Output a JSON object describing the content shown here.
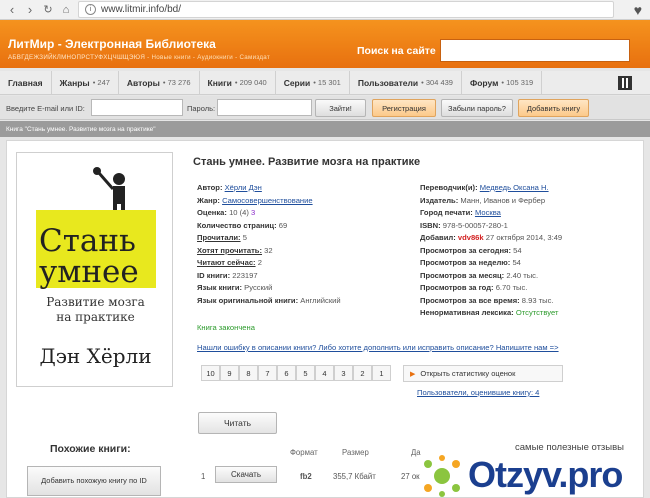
{
  "browser": {
    "url": "www.litmir.info/bd/"
  },
  "header": {
    "title": "ЛитМир - Электронная Библиотека",
    "alphabet": "АБВГДЕЖЗИЙКЛМНОПРСТУФХЦЧШЩЭЮЯ",
    "sublinks": "- Новые книги - Аудиокниги - Самиздат",
    "search_label": "Поиск на сайте"
  },
  "nav": [
    {
      "label": "Главная",
      "count": ""
    },
    {
      "label": "Жанры",
      "count": "• 247"
    },
    {
      "label": "Авторы",
      "count": "• 73 276"
    },
    {
      "label": "Книги",
      "count": "• 209 040"
    },
    {
      "label": "Серии",
      "count": "• 15 301"
    },
    {
      "label": "Пользователи",
      "count": "• 304 439"
    },
    {
      "label": "Форум",
      "count": "• 105 319"
    }
  ],
  "login": {
    "email_label": "Введите E-mail или ID:",
    "password_label": "Пароль:",
    "enter": "Зайти!",
    "register": "Регистрация",
    "forgot": "Забыли пароль?",
    "add_book": "Добавить книгу"
  },
  "breadcrumb": "Книга \"Стань умнее. Развитие мозга на практике\"",
  "cover": {
    "line1": "Стань",
    "line2": "умнее",
    "sub1": "Развитие мозга",
    "sub2": "на практике",
    "author": "Дэн Хёрли"
  },
  "book": {
    "title": "Стань умнее. Развитие мозга на практике",
    "left": [
      {
        "label": "Автор:",
        "value": "Хёрли Дэн",
        "link": true
      },
      {
        "label": "Жанр:",
        "value": "Самосовершенствование",
        "link": true
      },
      {
        "label": "Оценка:",
        "value": "10 (4)",
        "extra": "3"
      },
      {
        "label": "Количество страниц:",
        "value": "69"
      },
      {
        "label": "Прочитали:",
        "value": "5",
        "label_link": true
      },
      {
        "label": "Хотят прочитать:",
        "value": "32",
        "label_link": true
      },
      {
        "label": "Читают сейчас:",
        "value": "2",
        "label_link": true
      },
      {
        "label": "ID книги:",
        "value": "223197"
      },
      {
        "label": "Язык книги:",
        "value": "Русский"
      },
      {
        "label": "Язык оригинальной книги:",
        "value": "Английский"
      }
    ],
    "finished": "Книга закончена",
    "right": [
      {
        "label": "Переводчик(и):",
        "value": "Медведь Оксана Н.",
        "link": true
      },
      {
        "label": "Издатель:",
        "value": "Манн, Иванов и Фербер"
      },
      {
        "label": "Город печати:",
        "value": "Москва",
        "link": true
      },
      {
        "label": "ISBN:",
        "value": "978-5-00057-280-1"
      },
      {
        "label": "Добавил:",
        "user": "vdv86k",
        "value": "27 октября 2014, 3:49"
      },
      {
        "label": "Просмотров за сегодня:",
        "value": "54"
      },
      {
        "label": "Просмотров за неделю:",
        "value": "54"
      },
      {
        "label": "Просмотров за месяц:",
        "value": "2.40 тыс."
      },
      {
        "label": "Просмотров за год:",
        "value": "6.70 тыс."
      },
      {
        "label": "Просмотров за все время:",
        "value": "8.93 тыс."
      },
      {
        "label": "Ненормативная лексика:",
        "value": "Отсутствует",
        "green": true
      }
    ],
    "problem": "Нашли ошибку в описании книги? Либо хотите дополнить или исправить описание? Напишите нам =>"
  },
  "rating": {
    "pages": [
      "10",
      "9",
      "8",
      "7",
      "6",
      "5",
      "4",
      "3",
      "2",
      "1"
    ],
    "stats_button": "Открыть статистику оценок",
    "users_rated": "Пользователи, оценившие книгу: 4"
  },
  "read_button": "Читать",
  "similar": {
    "title": "Похожие книги:",
    "add_button": "Добавить похожую книгу по ID"
  },
  "downloads": {
    "headers": [
      "Формат",
      "Размер",
      "Да"
    ],
    "row": {
      "num": "1",
      "button": "Скачать",
      "format": "fb2",
      "size": "355,7 Кбайт",
      "date": "27 ок"
    }
  },
  "watermark": {
    "tagline": "самые полезные отзывы",
    "brand": "Otzyv.pro"
  }
}
